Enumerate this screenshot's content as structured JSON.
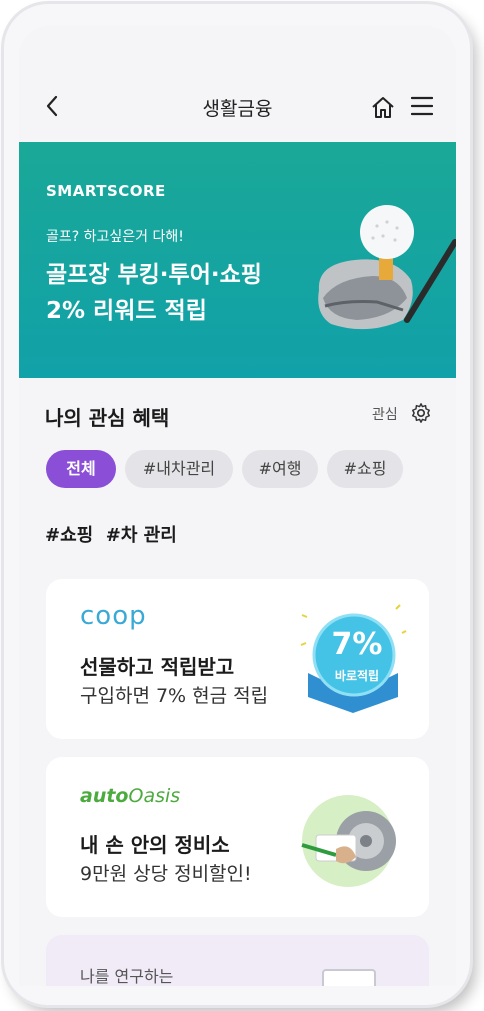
{
  "header": {
    "title": "생활금융"
  },
  "banner": {
    "brand": "SMARTSCORE",
    "subtitle": "골프? 하고싶은거 다해!",
    "line1": "골프장 부킹·투어·쇼핑",
    "line2": "2% 리워드 적립",
    "bg": "#14a5a0"
  },
  "benefits": {
    "title": "나의 관심 혜택",
    "settings_label": "관심",
    "chips": [
      {
        "label": "전체",
        "active": true
      },
      {
        "label": "#내차관리",
        "active": false
      },
      {
        "label": "#여행",
        "active": false
      },
      {
        "label": "#쇼핑",
        "active": false
      }
    ],
    "tags": "#쇼핑  #차 관리",
    "accent": "#8a4fd6"
  },
  "cards": [
    {
      "brand": "coop",
      "line1": "선물하고 적립받고",
      "line2": "구입하면 7% 현금 적립",
      "badge_value": "7%",
      "badge_label": "바로적립"
    },
    {
      "brand_a": "auto",
      "brand_b": "Oasis",
      "line1": "내 손 안의 정비소",
      "line2": "9만원 상당 정비할인!"
    },
    {
      "line1": "나를 연구하는"
    }
  ]
}
